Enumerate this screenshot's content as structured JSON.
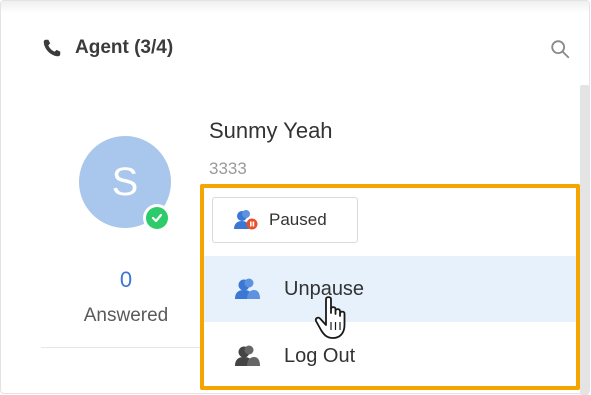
{
  "header": {
    "title": "Agent (3/4)",
    "icon": "phone-icon",
    "search_icon": "search-icon"
  },
  "agent": {
    "avatar_initial": "S",
    "name": "Sunmy Yeah",
    "extension": "3333",
    "status_indicator": "online-check",
    "answered_count": "0",
    "answered_label": "Answered"
  },
  "status_button": {
    "label": "Paused",
    "icon": "agent-paused-icon"
  },
  "menu": {
    "items": [
      {
        "label": "Unpause",
        "icon": "agent-unpause-icon",
        "hovered": true
      },
      {
        "label": "Log Out",
        "icon": "agent-logout-icon",
        "hovered": false
      }
    ]
  },
  "colors": {
    "highlight": "#f5a400",
    "avatar": "#a9c6ec",
    "online": "#2ecb6a",
    "accent": "#3a78d3",
    "hover": "#e6f1fb",
    "paused_badge": "#e8502a",
    "agent_icon_blue": "#3a78d3",
    "agent_icon_dark": "#444444"
  }
}
